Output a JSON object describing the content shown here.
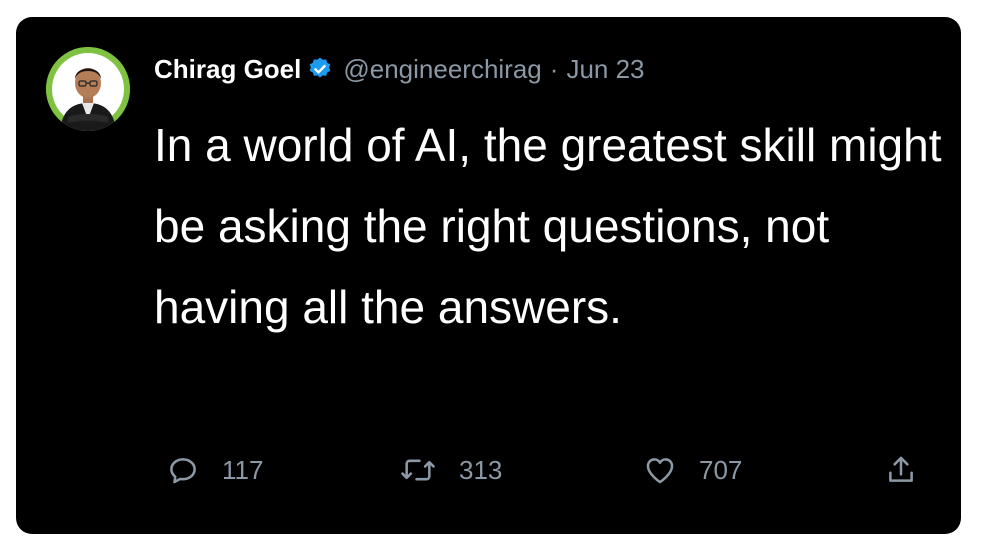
{
  "tweet": {
    "author": {
      "name": "Chirag Goel",
      "handle": "@engineerchirag",
      "verified": true,
      "avatar_ring_color": "#7fc241"
    },
    "separator": "·",
    "date": "Jun 23",
    "text": "In a world of AI, the greatest skill might be asking the right questions, not having all the answers.",
    "actions": {
      "replies": "117",
      "retweets": "313",
      "likes": "707"
    }
  },
  "colors": {
    "card_background": "#000000",
    "text_primary": "#ffffff",
    "text_secondary": "#8b98a5",
    "verified_badge": "#1d9bf0"
  },
  "icons": {
    "reply": "reply-icon",
    "retweet": "retweet-icon",
    "like": "heart-icon",
    "share": "share-icon",
    "verified": "verified-badge-icon"
  }
}
